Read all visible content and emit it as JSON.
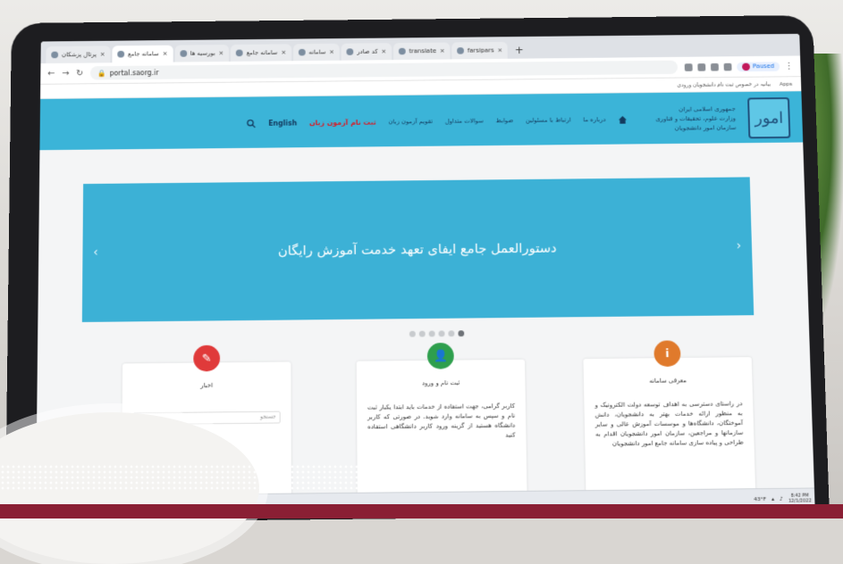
{
  "browser": {
    "tabs": [
      {
        "label": "پرتال پزشکان"
      },
      {
        "label": "سامانه جامع"
      },
      {
        "label": "بورسیه ها"
      },
      {
        "label": "سامانه جامع"
      },
      {
        "label": "سامانه"
      },
      {
        "label": "کد صادر"
      },
      {
        "label": "translate"
      },
      {
        "label": "farsipars"
      }
    ],
    "new_tab": "+",
    "close_symbol": "×",
    "url": "portal.saorg.ir",
    "profile_label": "Paused",
    "bookmark_items": [
      "Apps",
      "بیانیه در خصوص ثبت نام دانشجویان ورودی"
    ]
  },
  "site": {
    "logo_glyph": "امور",
    "org_lines": [
      "جمهوری اسلامی ایران",
      "وزارت علوم، تحقیقات و فناوری",
      "سازمان امور دانشجویان"
    ],
    "nav": [
      {
        "label": "درباره ما"
      },
      {
        "label": "ارتباط با مسئولین"
      },
      {
        "label": "ضوابط"
      },
      {
        "label": "سوالات متداول"
      },
      {
        "label": "تقویم آزمون زبان"
      }
    ],
    "register_label": "ثبت نام آزمون زبان",
    "english_label": "English"
  },
  "slider": {
    "text": "دستورالعمل جامع ایفای تعهد خدمت آموزش رایگان",
    "prev": "‹",
    "next": "›"
  },
  "cards": [
    {
      "title": "معرفی سامانه",
      "icon_glyph": "i",
      "color": "#e07a2c",
      "body": "در راستای دسترسی به اهداف توسعه دولت الکترونیک و به منظور ارائه خدمات بهتر به دانشجویان، دانش آموختگان، دانشگاه‌ها و موسسات آموزش عالی و سایر سازمانها و مراجعین، سازمان امور دانشجویان اقدام به طراحی و پیاده سازی سامانه جامع امور دانشجویان"
    },
    {
      "title": "ثبت نام و ورود",
      "icon_glyph": "👤",
      "color": "#2e9f4d",
      "body": "کاربر گرامی، جهت استفاده از خدمات باید ابتدا یکبار ثبت نام و سپس به سامانه وارد شوید. در صورتی که کاربر دانشگاه هستید از گزینه ورود کاربر دانشگاهی استفاده کنید"
    },
    {
      "title": "اخبار",
      "icon_glyph": "✎",
      "color": "#e03a3a",
      "search_placeholder": "جستجو"
    }
  ],
  "taskbar": {
    "temp": "43°F",
    "time": "8:42 PM",
    "date": "12/1/2022"
  }
}
